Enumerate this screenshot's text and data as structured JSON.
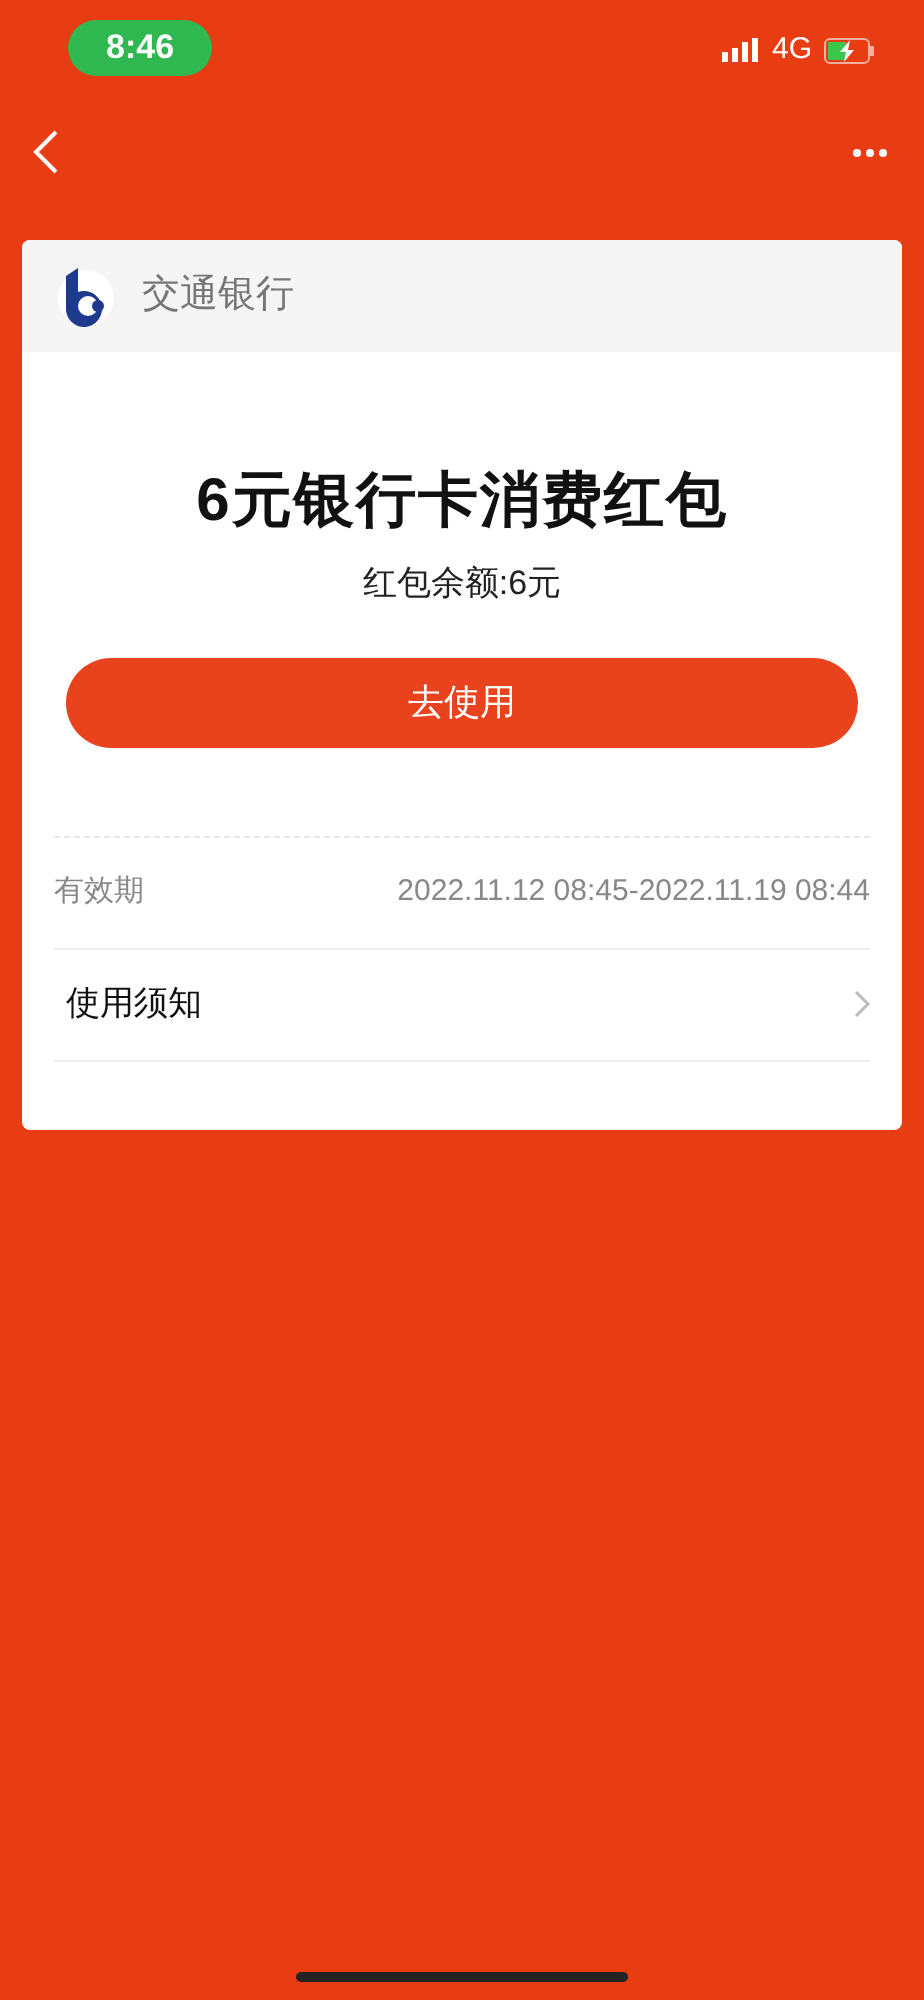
{
  "status_bar": {
    "time": "8:46",
    "network": "4G"
  },
  "bank": {
    "name": "交通银行"
  },
  "coupon": {
    "title": "6元银行卡消费红包",
    "balance": "红包余额:6元",
    "use_button": "去使用"
  },
  "details": [
    {
      "kind": "info",
      "label": "有效期",
      "value": "2022.11.12 08:45-2022.11.19 08:44"
    },
    {
      "kind": "link",
      "label": "使用须知"
    }
  ]
}
